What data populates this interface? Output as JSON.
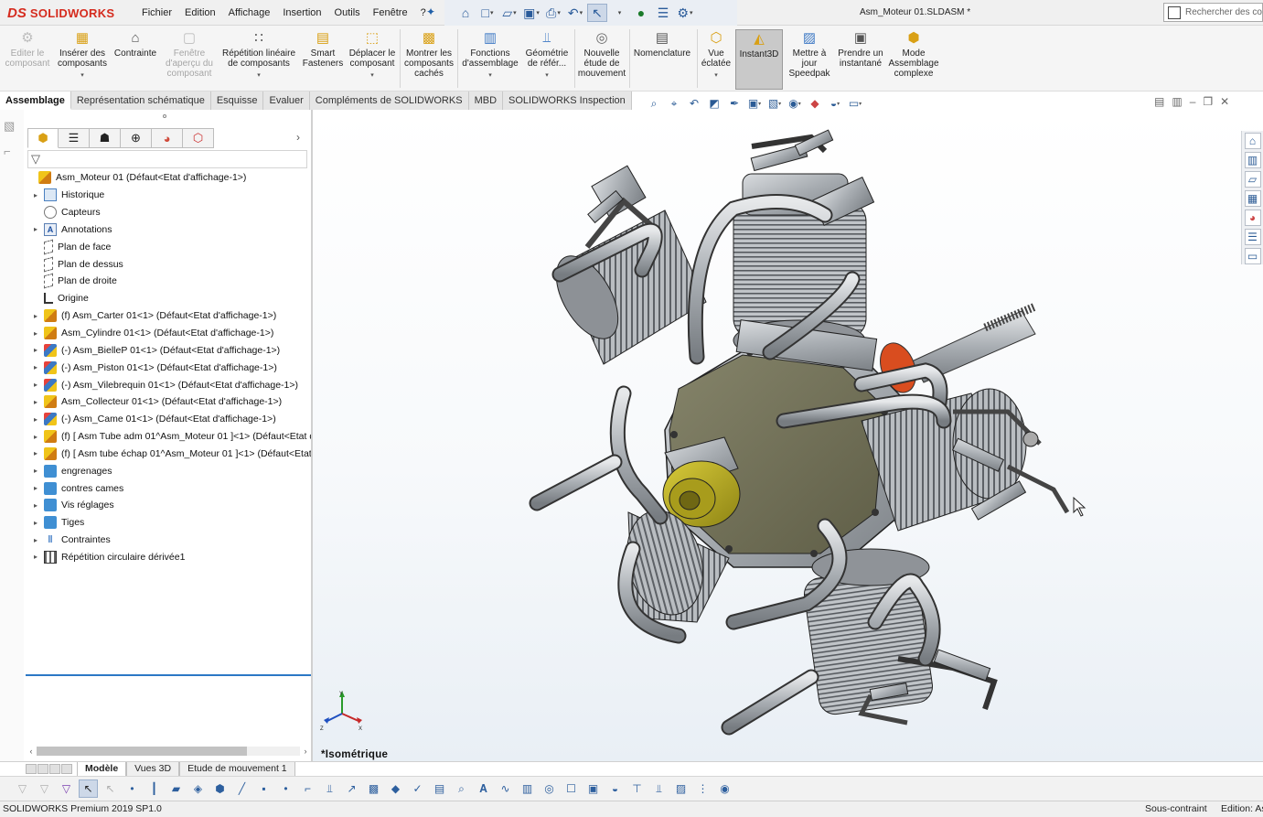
{
  "app": {
    "brand_mark": "DS",
    "brand_name": "SOLIDWORKS",
    "document_title": "Asm_Moteur 01.SLDASM *"
  },
  "menu": [
    "Fichier",
    "Edition",
    "Affichage",
    "Insertion",
    "Outils",
    "Fenêtre",
    "?"
  ],
  "search": {
    "placeholder": "Rechercher des commandes"
  },
  "quick_access_icons": [
    "home-icon",
    "new-document-icon",
    "open-icon",
    "save-icon",
    "print-icon",
    "undo-icon",
    "select-icon",
    "traffic-light-icon",
    "file-properties-icon",
    "options-gear-icon"
  ],
  "ribbon": [
    {
      "label": "Editer le composant",
      "icon": "edit-component-icon",
      "disabled": true
    },
    {
      "label": "Insérer des composants",
      "icon": "insert-components-icon",
      "dropdown": true
    },
    {
      "label": "Contrainte",
      "icon": "mate-paperclip-icon"
    },
    {
      "label": "Fenêtre d'aperçu du composant",
      "icon": "preview-window-icon",
      "disabled": true
    },
    {
      "label": "Répétition linéaire de composants",
      "icon": "linear-pattern-icon",
      "dropdown": true
    },
    {
      "label": "Smart Fasteners",
      "icon": "smart-fasteners-icon"
    },
    {
      "label": "Déplacer le composant",
      "icon": "move-component-icon",
      "dropdown": true
    },
    {
      "label": "Montrer les composants cachés",
      "icon": "show-hidden-icon"
    },
    {
      "label": "Fonctions d'assemblage",
      "icon": "assembly-features-icon",
      "dropdown": true
    },
    {
      "label": "Géométrie de référ...",
      "icon": "reference-geometry-icon",
      "dropdown": true
    },
    {
      "label": "Nouvelle étude de mouvement",
      "icon": "motion-study-icon"
    },
    {
      "label": "Nomenclature",
      "icon": "bom-icon"
    },
    {
      "label": "Vue éclatée",
      "icon": "exploded-view-icon",
      "dropdown": true
    },
    {
      "label": "Instant3D",
      "icon": "instant3d-icon",
      "active": true
    },
    {
      "label": "Mettre à jour Speedpak",
      "icon": "speedpak-icon"
    },
    {
      "label": "Prendre un instantané",
      "icon": "camera-icon"
    },
    {
      "label": "Mode Assemblage complexe",
      "icon": "large-assembly-icon"
    }
  ],
  "command_tabs": [
    {
      "label": "Assemblage",
      "active": true
    },
    {
      "label": "Représentation schématique"
    },
    {
      "label": "Esquisse"
    },
    {
      "label": "Evaluer"
    },
    {
      "label": "Compléments de SOLIDWORKS"
    },
    {
      "label": "MBD"
    },
    {
      "label": "SOLIDWORKS Inspection"
    }
  ],
  "feature_tree": {
    "root": "Asm_Moteur 01  (Défaut<Etat d'affichage-1>)",
    "items": [
      {
        "label": "Historique",
        "icon": "history-icon",
        "expand": true
      },
      {
        "label": "Capteurs",
        "icon": "sensor-icon",
        "expand": false
      },
      {
        "label": "Annotations",
        "icon": "annotations-icon",
        "expand": true
      },
      {
        "label": "Plan de face",
        "icon": "plane-icon",
        "expand": false
      },
      {
        "label": "Plan de dessus",
        "icon": "plane-icon",
        "expand": false
      },
      {
        "label": "Plan de droite",
        "icon": "plane-icon",
        "expand": false
      },
      {
        "label": "Origine",
        "icon": "origin-icon",
        "expand": false
      },
      {
        "label": "(f) Asm_Carter 01<1> (Défaut<Etat d'affichage-1>)",
        "icon": "subassembly-icon",
        "expand": true
      },
      {
        "label": "Asm_Cylindre 01<1> (Défaut<Etat d'affichage-1>)",
        "icon": "subassembly-icon",
        "expand": true
      },
      {
        "label": "(-) Asm_BielleP 01<1> (Défaut<Etat d'affichage-1>)",
        "icon": "subassembly-color-icon",
        "expand": true
      },
      {
        "label": "(-) Asm_Piston 01<1> (Défaut<Etat d'affichage-1>)",
        "icon": "subassembly-color-icon",
        "expand": true
      },
      {
        "label": "(-) Asm_Vilebrequin 01<1> (Défaut<Etat d'affichage-1>)",
        "icon": "subassembly-color-icon",
        "expand": true
      },
      {
        "label": "Asm_Collecteur 01<1> (Défaut<Etat d'affichage-1>)",
        "icon": "subassembly-icon",
        "expand": true
      },
      {
        "label": "(-) Asm_Came 01<1> (Défaut<Etat d'affichage-1>)",
        "icon": "subassembly-color-icon",
        "expand": true
      },
      {
        "label": "(f) [ Asm Tube adm 01^Asm_Moteur 01 ]<1> (Défaut<Etat d",
        "icon": "subassembly-icon",
        "expand": true
      },
      {
        "label": "(f) [ Asm tube échap 01^Asm_Moteur 01 ]<1> (Défaut<Etat d",
        "icon": "subassembly-icon",
        "expand": true
      },
      {
        "label": "engrenages",
        "icon": "folder-icon",
        "expand": true
      },
      {
        "label": "contres cames",
        "icon": "folder-icon",
        "expand": true
      },
      {
        "label": "Vis réglages",
        "icon": "folder-icon",
        "expand": true
      },
      {
        "label": "Tiges",
        "icon": "folder-icon",
        "expand": true
      },
      {
        "label": "Contraintes",
        "icon": "mates-icon",
        "expand": true
      },
      {
        "label": "Répétition circulaire dérivée1",
        "icon": "circular-pattern-icon",
        "expand": true
      }
    ]
  },
  "viewport": {
    "view_name": "*Isométrique",
    "triad_axes": [
      "Y",
      "X",
      "Z"
    ]
  },
  "bottom_tabs": [
    {
      "label": "Modèle",
      "active": true
    },
    {
      "label": "Vues 3D"
    },
    {
      "label": "Etude de mouvement 1"
    }
  ],
  "status": {
    "version": "SOLIDWORKS Premium 2019 SP1.0",
    "mate_state": "Sous-contraint",
    "edit_mode": "Edition: Assemblage"
  },
  "colors": {
    "brand_red": "#d52b1e",
    "selection_blue": "#2b78c5",
    "engine_gray": "#9ea3a8",
    "crankcase_olive": "#6f6e55",
    "hub_yellow": "#b5a81c",
    "prop_orange": "#d94d1f"
  }
}
